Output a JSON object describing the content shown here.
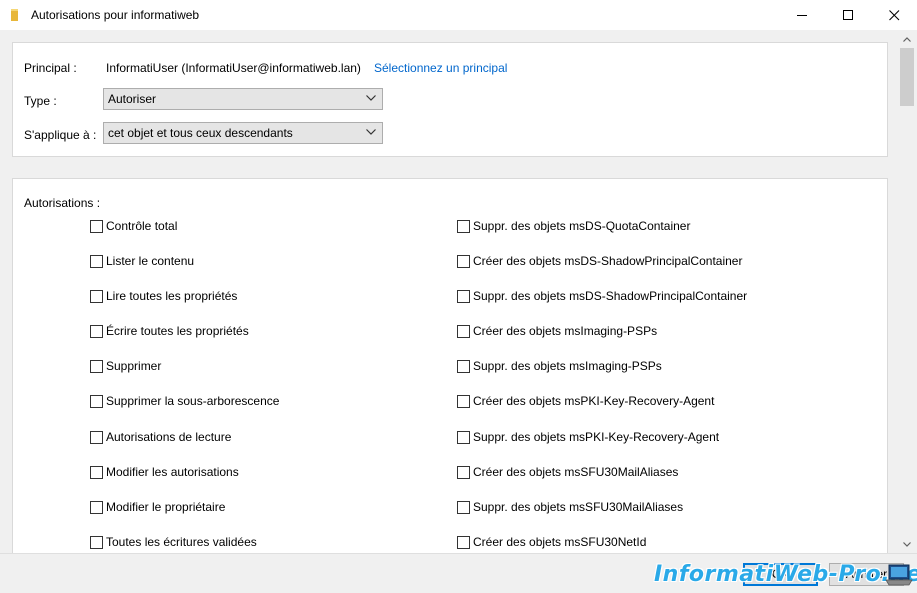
{
  "window": {
    "title": "Autorisations pour informatiweb",
    "folder_icon_color": "#e8b73a"
  },
  "principal": {
    "label": "Principal :",
    "value": "InformatiUser (InformatiUser@informatiweb.lan)",
    "select_link": "Sélectionnez un principal"
  },
  "type": {
    "label": "Type :",
    "selected": "Autoriser"
  },
  "applies_to": {
    "label": "S'applique à :",
    "selected": "cet objet et tous ceux descendants"
  },
  "permissions": {
    "label": "Autorisations :",
    "left": [
      {
        "label": "Contrôle total",
        "checked": false
      },
      {
        "label": "Lister le contenu",
        "checked": false
      },
      {
        "label": "Lire toutes les propriétés",
        "checked": false
      },
      {
        "label": "Écrire toutes les propriétés",
        "checked": false
      },
      {
        "label": "Supprimer",
        "checked": false
      },
      {
        "label": "Supprimer la sous-arborescence",
        "checked": false
      },
      {
        "label": "Autorisations de lecture",
        "checked": false
      },
      {
        "label": "Modifier les autorisations",
        "checked": false
      },
      {
        "label": "Modifier le propriétaire",
        "checked": false
      },
      {
        "label": "Toutes les écritures validées",
        "checked": false
      }
    ],
    "right": [
      {
        "label": "Suppr. des objets msDS-QuotaContainer",
        "checked": false
      },
      {
        "label": "Créer des objets msDS-ShadowPrincipalContainer",
        "checked": false
      },
      {
        "label": "Suppr. des objets msDS-ShadowPrincipalContainer",
        "checked": false
      },
      {
        "label": "Créer des objets msImaging-PSPs",
        "checked": false
      },
      {
        "label": "Suppr. des objets msImaging-PSPs",
        "checked": false
      },
      {
        "label": "Créer des objets msPKI-Key-Recovery-Agent",
        "checked": false
      },
      {
        "label": "Suppr. des objets msPKI-Key-Recovery-Agent",
        "checked": false
      },
      {
        "label": "Créer des objets msSFU30MailAliases",
        "checked": false
      },
      {
        "label": "Suppr. des objets msSFU30MailAliases",
        "checked": false
      },
      {
        "label": "Créer des objets msSFU30NetId",
        "checked": false
      }
    ]
  },
  "footer": {
    "ok_label": "OK",
    "cancel_label": "Annuler"
  },
  "watermark": {
    "text": "InformatiWeb-Pro.net"
  }
}
